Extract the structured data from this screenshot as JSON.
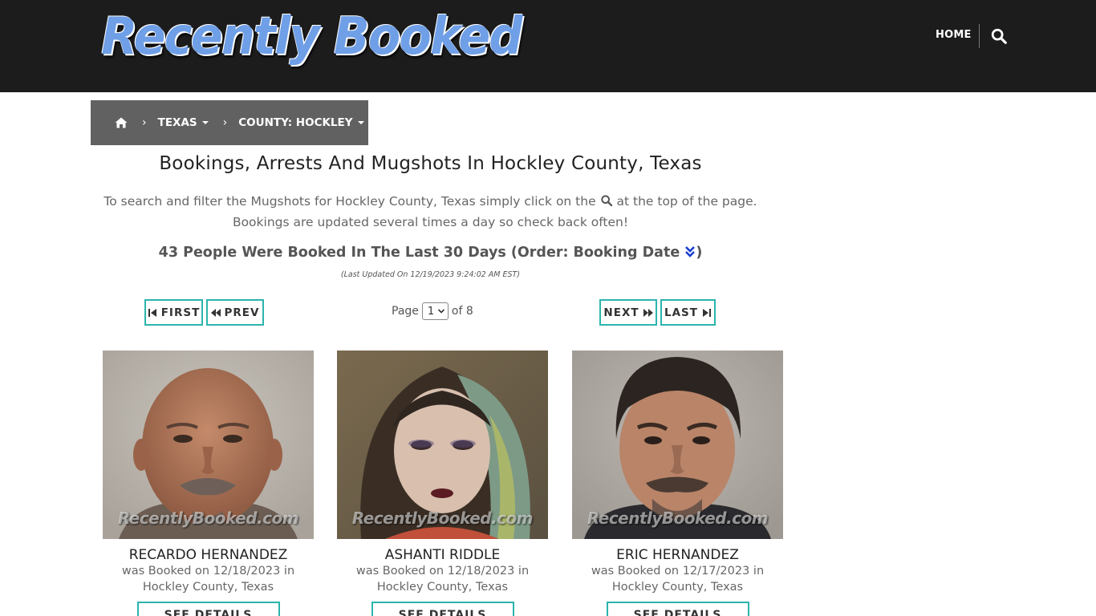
{
  "header": {
    "logo_text": "Recently Booked",
    "nav_home": "HOME"
  },
  "breadcrumb": {
    "state": "TEXAS",
    "county": "COUNTY: HOCKLEY"
  },
  "main": {
    "title": "Bookings, Arrests And Mugshots In Hockley County, Texas",
    "desc_line1_before": "To search and filter the Mugshots for Hockley County, Texas simply click on the",
    "desc_line1_after": "at the top of the page.",
    "desc_line2": "Bookings are updated several times a day so check back often!",
    "count_text": "43 People Were Booked In The Last 30 Days (Order: Booking Date",
    "count_close": ")",
    "updated": "(Last Updated On 12/19/2023 9:24:02 AM EST)"
  },
  "pagination": {
    "first": "FIRST",
    "prev": "PREV",
    "next": "NEXT",
    "last": "LAST",
    "page_label": "Page",
    "page_value": "1",
    "of_label": "of 8"
  },
  "cards": [
    {
      "name": "RECARDO HERNANDEZ",
      "booked_line": "was Booked on 12/18/2023 in",
      "location": "Hockley County, Texas",
      "watermark": "RecentlyBooked.com",
      "button": "SEE DETAILS"
    },
    {
      "name": "ASHANTI RIDDLE",
      "booked_line": "was Booked on 12/18/2023 in",
      "location": "Hockley County, Texas",
      "watermark": "RecentlyBooked.com",
      "button": "SEE DETAILS"
    },
    {
      "name": "ERIC HERNANDEZ",
      "booked_line": "was Booked on 12/17/2023 in",
      "location": "Hockley County, Texas",
      "watermark": "RecentlyBooked.com",
      "button": "SEE DETAILS"
    }
  ],
  "colors": {
    "topbar": "#1c1c1c",
    "breadcrumb": "#616161",
    "accent_teal": "#2bb5ad",
    "order_icon": "#1a3fd0"
  },
  "icons": [
    "home-icon",
    "search-icon",
    "chevron-right-icon",
    "caret-down-icon",
    "step-backward-icon",
    "backward-icon",
    "forward-icon",
    "step-forward-icon",
    "double-chevron-down-icon"
  ]
}
